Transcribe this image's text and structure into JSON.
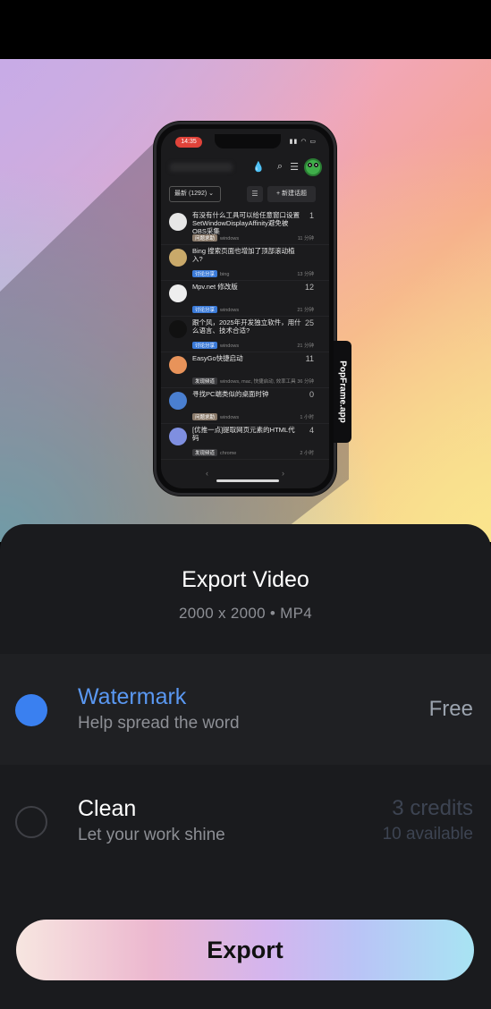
{
  "preview": {
    "side_tab_label": "PopFrame.app",
    "phone": {
      "time": "14:35",
      "sort_label": "最新 (1292)",
      "new_topic_label": "+ 新建话题",
      "topics": [
        {
          "title": "有没有什么工具可以给任意窗口设置SetWindowDisplayAffinity避免被OBS采集",
          "count": "1",
          "tag": "问题求助",
          "tag_color": "#8a7a6a",
          "meta": "windows",
          "when": "11 分钟",
          "avatar_color": "#e6e6e6"
        },
        {
          "title": "Bing 搜索页面也增加了顶部滚动植入?",
          "count": "",
          "tag": "讨论分享",
          "tag_color": "#3a7ad8",
          "meta": "bing",
          "when": "13 分钟",
          "avatar_color": "#c9a96a"
        },
        {
          "title": "Mpv.net 修改版",
          "count": "12",
          "tag": "讨论分享",
          "tag_color": "#3a7ad8",
          "meta": "windows",
          "when": "21 分钟",
          "avatar_color": "#eeeeee"
        },
        {
          "title": "跟个风，2025年开发独立软件，用什么语言、技术合适?",
          "count": "25",
          "tag": "讨论分享",
          "tag_color": "#3a7ad8",
          "meta": "windows",
          "when": "21 分钟",
          "avatar_color": "#111111"
        },
        {
          "title": "EasyGo快捷启动",
          "count": "11",
          "tag": "发现频道",
          "tag_color": "#3a3a3d",
          "meta": "windows, mac, 快捷启动, 效率工具",
          "when": "36 分钟",
          "avatar_color": "#e8935a"
        },
        {
          "title": "寻找PC端类似的桌面时钟",
          "count": "0",
          "tag": "问题求助",
          "tag_color": "#8a7a6a",
          "meta": "windows",
          "when": "1 小时",
          "avatar_color": "#4a7fd0"
        },
        {
          "title": "[优推一点]提取网页元素的HTML代码",
          "count": "4",
          "tag": "发现频道",
          "tag_color": "#3a3a3d",
          "meta": "chrome",
          "when": "2 小时",
          "avatar_color": "#7f8fe0"
        }
      ]
    }
  },
  "sheet": {
    "title": "Export Video",
    "subtitle": "2000 x 2000 • MP4",
    "options": {
      "watermark": {
        "title": "Watermark",
        "desc": "Help spread the word",
        "price": "Free",
        "selected": true
      },
      "clean": {
        "title": "Clean",
        "desc": "Let your work shine",
        "price": "3 credits",
        "available": "10 available",
        "selected": false
      }
    },
    "export_label": "Export"
  },
  "colors": {
    "accent": "#3a80f0",
    "sheet_bg": "#1a1b1e"
  }
}
